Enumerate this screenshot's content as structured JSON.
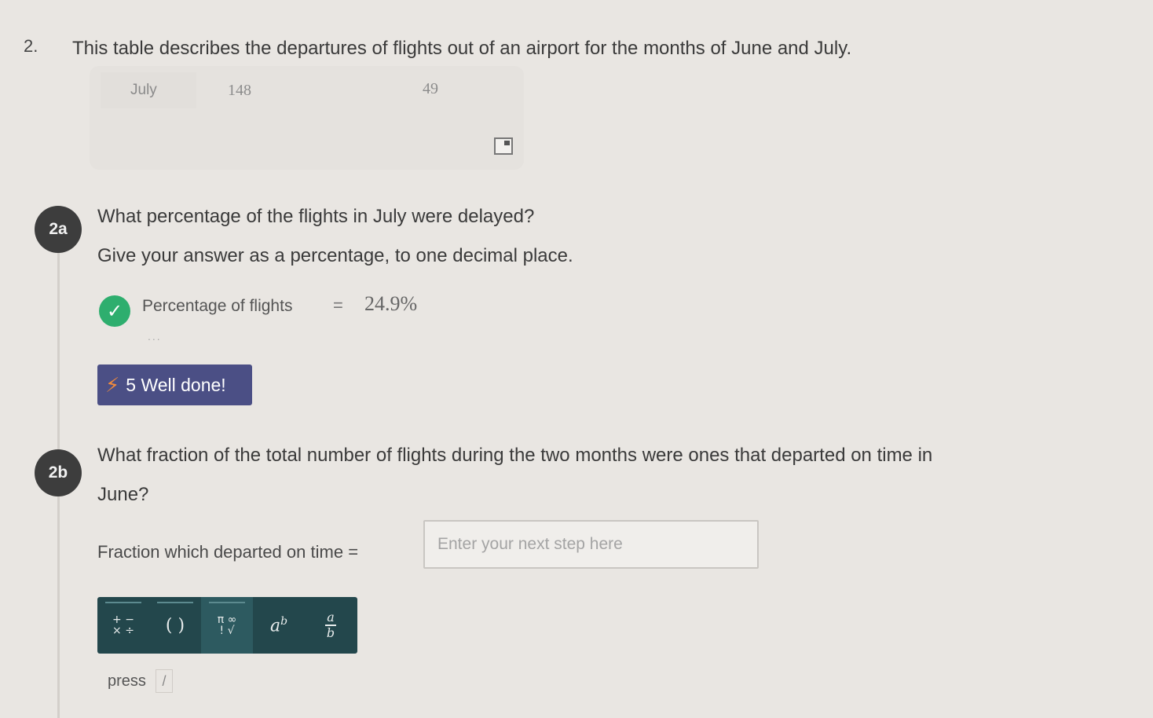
{
  "question": {
    "number": "2.",
    "title": "This table describes the departures of flights out of an airport for the months of June and July."
  },
  "table": {
    "visible_row": {
      "month": "July",
      "value_a": "148",
      "value_b": "49"
    }
  },
  "part_2a": {
    "badge": "2a",
    "question": "What percentage of the flights in July were delayed?",
    "instruction": "Give your answer as a percentage, to one decimal place.",
    "answer_label": "Percentage of flights",
    "answer_eq": "=",
    "answer_value": "24.9%",
    "ellipsis": "...",
    "reward": {
      "text": "5 Well done!"
    }
  },
  "part_2b": {
    "badge": "2b",
    "question_line1": "What fraction of the total number of flights during the two months were ones that departed on time in",
    "question_line2": "June?",
    "input_label": "Fraction which departed on time",
    "input_eq": "=",
    "input_placeholder": "Enter your next step here"
  },
  "toolbar": {
    "tools": [
      {
        "name": "operators",
        "icon": "operators-icon"
      },
      {
        "name": "brackets",
        "icon": "brackets-icon",
        "label": "( )"
      },
      {
        "name": "symbols",
        "icon": "pi-infinity-root-icon"
      },
      {
        "name": "power",
        "icon": "power-icon"
      },
      {
        "name": "fraction",
        "icon": "fraction-icon"
      }
    ]
  },
  "hint": {
    "press": "press",
    "key": "/"
  },
  "colors": {
    "background": "#e9e6e2",
    "badge": "#3d3d3d",
    "check": "#2eae6e",
    "reward_bg": "#4b4f85",
    "bolt": "#f08a3d",
    "toolbar": "#23474c"
  }
}
